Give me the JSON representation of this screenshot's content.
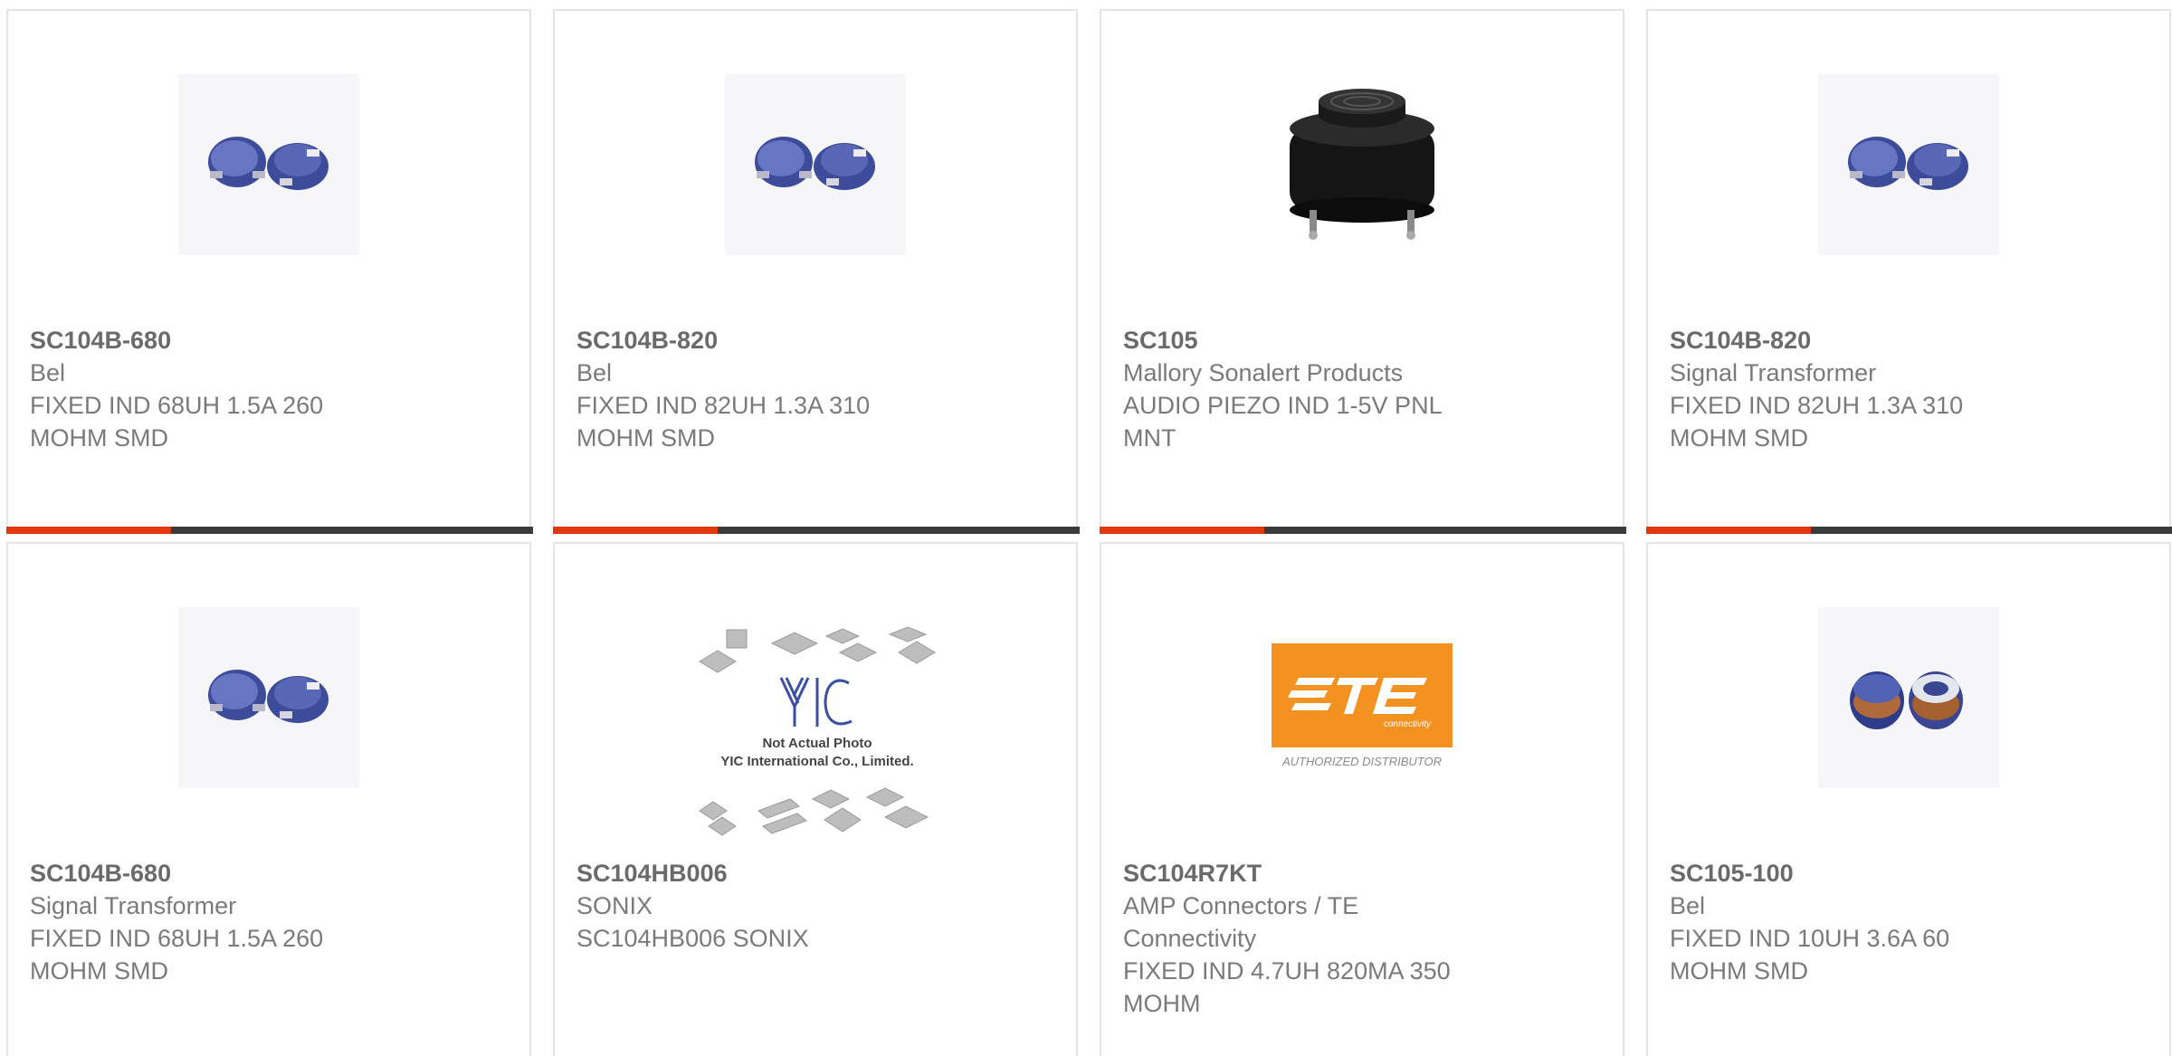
{
  "products": [
    {
      "part": "SC104B-680",
      "manufacturer": "Bel",
      "description": "FIXED IND 68UH 1.5A 260 MOHM SMD",
      "image_icon": "smd-inductor-image"
    },
    {
      "part": "SC104B-820",
      "manufacturer": "Bel",
      "description": "FIXED IND 82UH 1.3A 310 MOHM SMD",
      "image_icon": "smd-inductor-image"
    },
    {
      "part": "SC105",
      "manufacturer": "Mallory Sonalert Products",
      "description": "AUDIO PIEZO IND 1-5V PNL MNT",
      "image_icon": "piezo-buzzer-image"
    },
    {
      "part": "SC104B-820",
      "manufacturer": "Signal Transformer",
      "description": "FIXED IND 82UH 1.3A 310 MOHM SMD",
      "image_icon": "smd-inductor-image"
    },
    {
      "part": "SC104B-680",
      "manufacturer": "Signal Transformer",
      "description": "FIXED IND 68UH 1.5A 260 MOHM SMD",
      "image_icon": "smd-inductor-image"
    },
    {
      "part": "SC104HB006",
      "manufacturer": "SONIX",
      "description": "SC104HB006 SONIX",
      "image_icon": "yic-placeholder-image",
      "placeholder_lines": [
        "Not Actual Photo",
        "YIC International Co., Limited."
      ]
    },
    {
      "part": "SC104R7KT",
      "manufacturer": "AMP Connectors / TE Connectivity",
      "description": "FIXED IND 4.7UH 820MA 350 MOHM",
      "image_icon": "te-logo-image",
      "logo_sub": "connectivity",
      "logo_caption": "AUTHORIZED DISTRIBUTOR"
    },
    {
      "part": "SC105-100",
      "manufacturer": "Bel",
      "description": "FIXED IND 10UH 3.6A 60 MOHM SMD",
      "image_icon": "wound-inductor-image"
    }
  ],
  "colors": {
    "accent": "#e2380c",
    "bar": "#3b3b3b",
    "te_orange": "#f39220",
    "inductor_blue": "#4a5aa8"
  }
}
